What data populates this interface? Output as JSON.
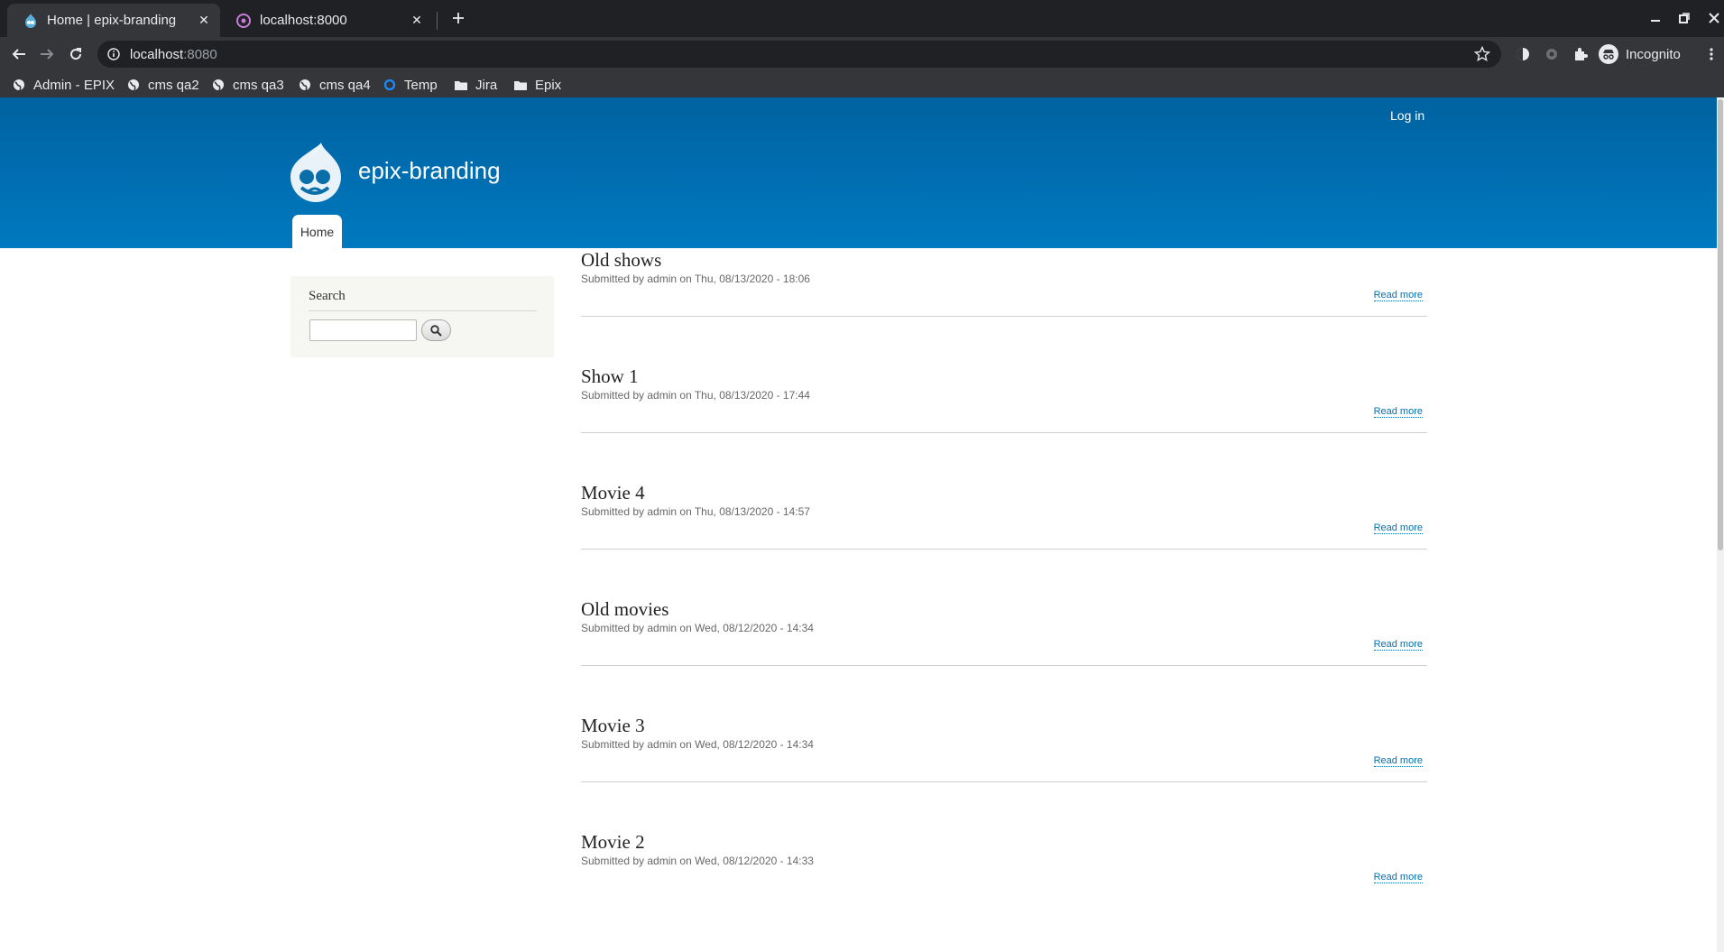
{
  "browser": {
    "tabs": [
      {
        "title": "Home | epix-branding",
        "active": true
      },
      {
        "title": "localhost:8000",
        "active": false
      }
    ],
    "url_host": "localhost",
    "url_port": ":8080",
    "profile_label": "Incognito",
    "bookmarks": [
      {
        "label": "Admin - EPIX",
        "icon": "globe-icon"
      },
      {
        "label": "cms qa2",
        "icon": "globe-icon"
      },
      {
        "label": "cms qa3",
        "icon": "globe-icon"
      },
      {
        "label": "cms qa4",
        "icon": "globe-icon"
      },
      {
        "label": "Temp",
        "icon": "circle-icon"
      },
      {
        "label": "Jira",
        "icon": "folder-icon"
      },
      {
        "label": "Epix",
        "icon": "folder-icon"
      }
    ]
  },
  "site": {
    "login_label": "Log in",
    "name": "epix-branding",
    "nav_home": "Home",
    "brand_color": "#0079c0"
  },
  "sidebar": {
    "search_title": "Search",
    "search_value": ""
  },
  "articles": [
    {
      "title": "Old shows",
      "meta": "Submitted by admin on Thu, 08/13/2020 - 18:06",
      "more": "Read more"
    },
    {
      "title": "Show 1",
      "meta": "Submitted by admin on Thu, 08/13/2020 - 17:44",
      "more": "Read more"
    },
    {
      "title": "Movie 4",
      "meta": "Submitted by admin on Thu, 08/13/2020 - 14:57",
      "more": "Read more"
    },
    {
      "title": "Old movies",
      "meta": "Submitted by admin on Wed, 08/12/2020 - 14:34",
      "more": "Read more"
    },
    {
      "title": "Movie 3",
      "meta": "Submitted by admin on Wed, 08/12/2020 - 14:34",
      "more": "Read more"
    },
    {
      "title": "Movie 2",
      "meta": "Submitted by admin on Wed, 08/12/2020 - 14:33",
      "more": "Read more"
    }
  ]
}
